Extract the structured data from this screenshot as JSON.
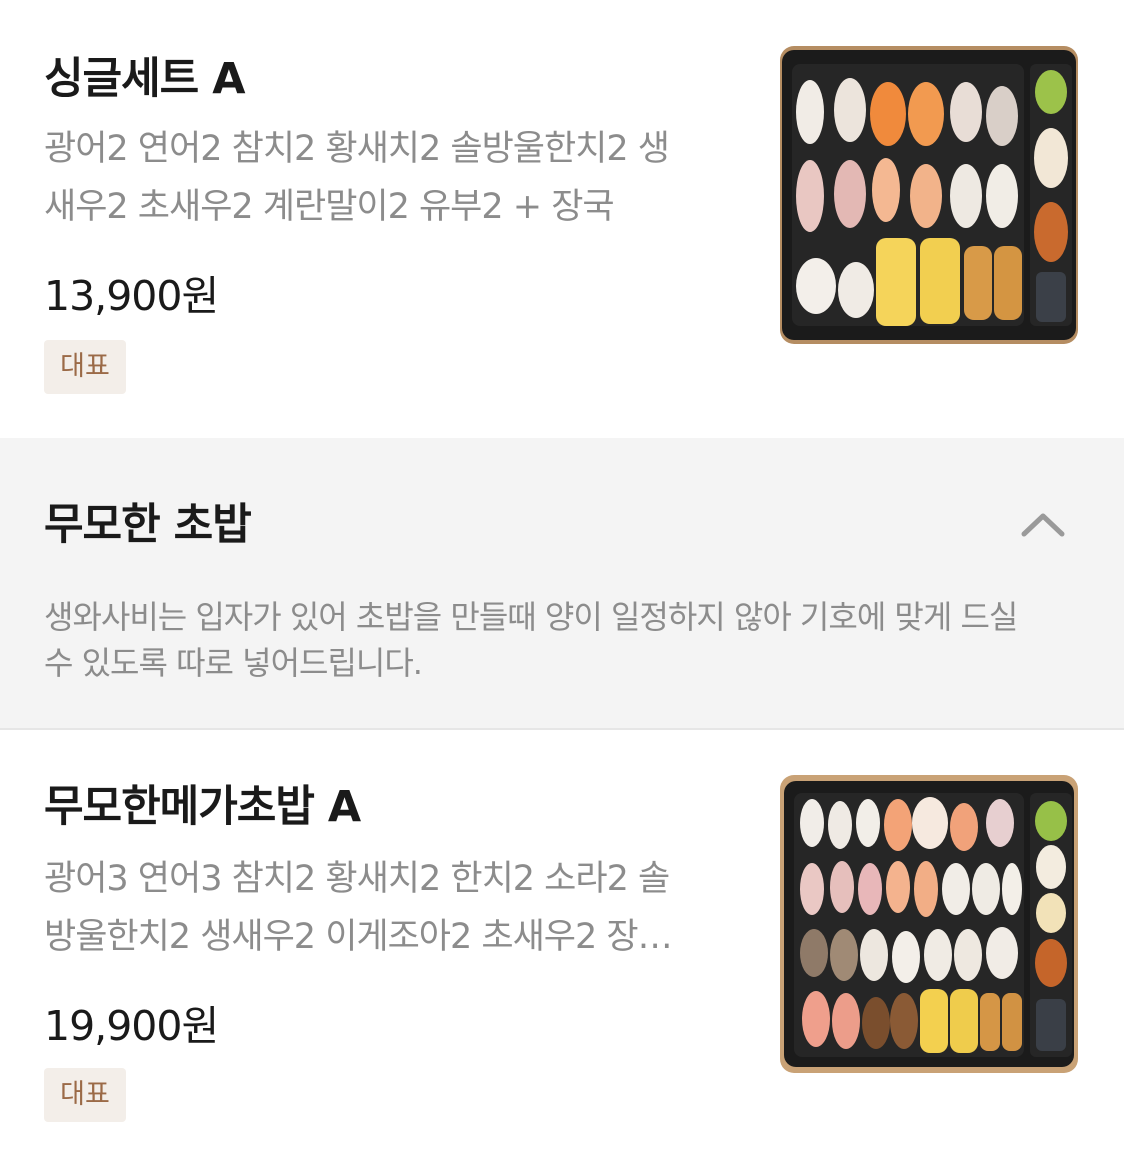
{
  "menu_items": [
    {
      "name": "싱글세트 A",
      "description_lines": [
        "광어2 연어2 참치2 황새치2 솔방울한치2 생",
        "새우2 초새우2 계란말이2 유부2 + 장국"
      ],
      "price": "13,900원",
      "badge": "대표",
      "image_icon": "sushi-set-photo"
    },
    {
      "name": "무모한메가초밥 A",
      "description_lines": [
        "광어3 연어3 참치2 황새치2 한치2 소라2 솔",
        "방울한치2 생새우2 이게조아2 초새우2 장…"
      ],
      "price": "19,900원",
      "badge": "대표",
      "image_icon": "sushi-mega-set-photo"
    }
  ],
  "section": {
    "title": "무모한 초밥",
    "description_lines": [
      "생와사비는 입자가 있어 초밥을 만들때 양이 일정하지 않아 기호에 맞게 드실",
      "수 있도록 따로 넣어드립니다."
    ],
    "toggle_icon": "chevron-up-icon",
    "expanded": true
  },
  "colors": {
    "badge_bg": "#f3eee9",
    "badge_text": "#9b6a47",
    "section_bg": "#f4f4f4",
    "muted_text": "#8c8c8c"
  }
}
